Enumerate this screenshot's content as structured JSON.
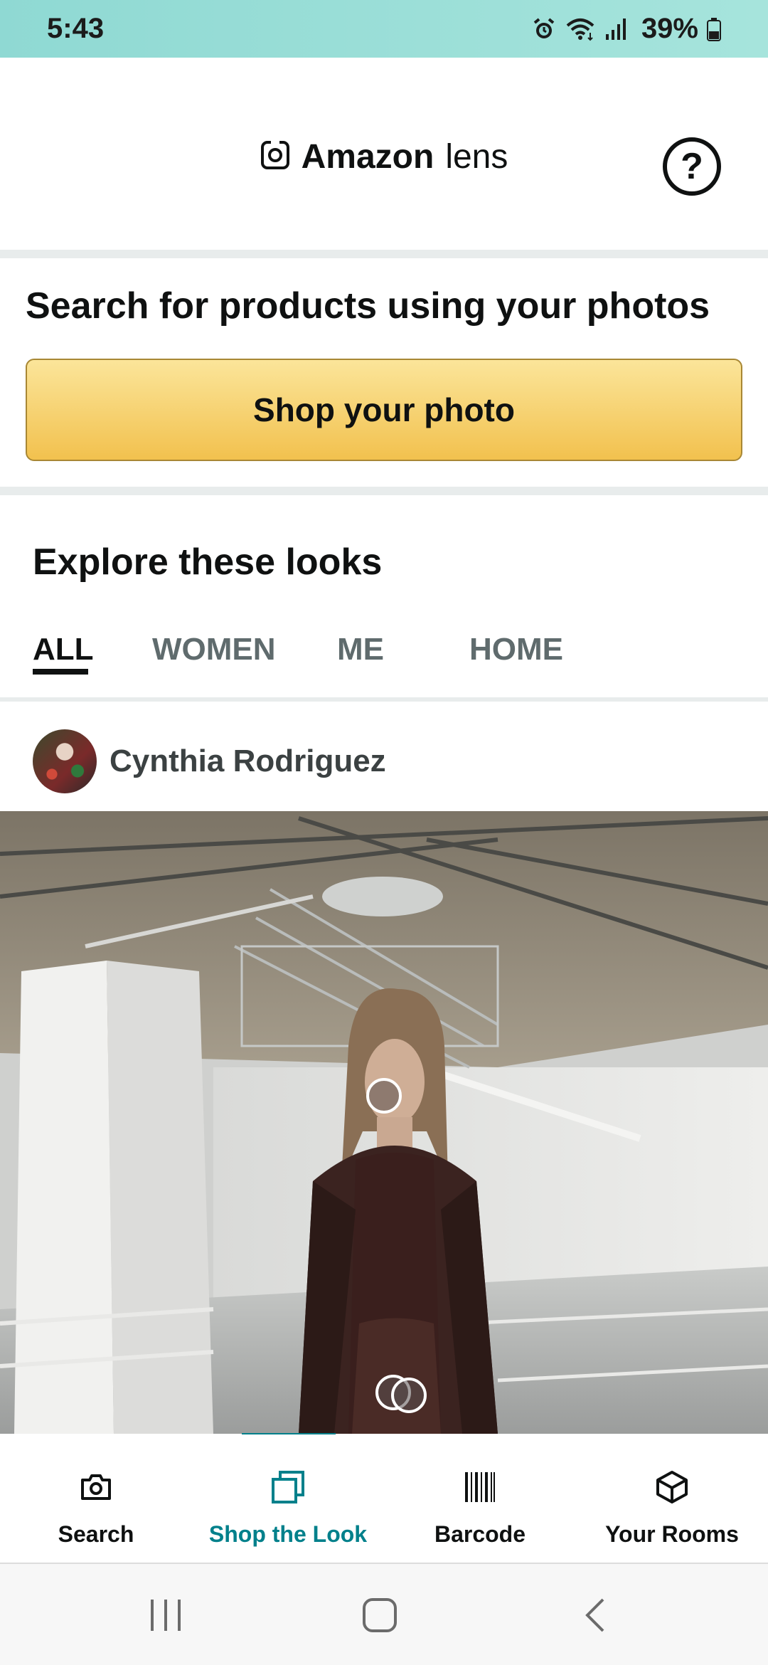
{
  "status_bar": {
    "time": "5:43",
    "battery": "39%",
    "icons": [
      "alarm-icon",
      "wifi-icon",
      "signal-icon",
      "battery-icon"
    ]
  },
  "header": {
    "brand_name": "Amazon",
    "brand_sub": "lens",
    "help_label": "?"
  },
  "hero": {
    "title": "Search for products using your photos",
    "button_label": "Shop your photo"
  },
  "explore": {
    "title": "Explore these looks",
    "tabs": [
      {
        "label": "ALL",
        "active": true
      },
      {
        "label": "WOMEN",
        "active": false
      },
      {
        "label": "ME",
        "active": false
      },
      {
        "label": "HOME",
        "active": false
      }
    ]
  },
  "post": {
    "user_name": "Cynthia Rodriguez"
  },
  "bottom_nav": {
    "items": [
      {
        "label": "Search",
        "icon": "camera-icon",
        "active": false
      },
      {
        "label": "Shop the Look",
        "icon": "stacked-squares-icon",
        "active": true
      },
      {
        "label": "Barcode",
        "icon": "barcode-icon",
        "active": false
      },
      {
        "label": "Your Rooms",
        "icon": "cube-icon",
        "active": false
      }
    ]
  },
  "colors": {
    "accent": "#00808b",
    "button_yellow": "#f2c14e",
    "status_bar": "#8fd9d3"
  }
}
